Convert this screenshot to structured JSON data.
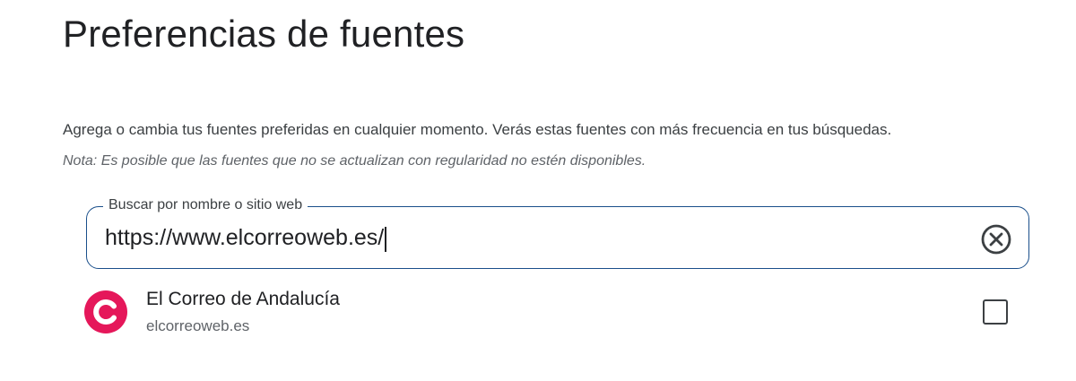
{
  "header": {
    "title": "Preferencias de fuentes"
  },
  "intro": {
    "description": "Agrega o cambia tus fuentes preferidas en cualquier momento. Verás estas fuentes con más frecuencia en tus búsquedas.",
    "note": "Nota: Es posible que las fuentes que no se actualizan con regularidad no estén disponibles."
  },
  "search": {
    "label": "Buscar por nombre o sitio web",
    "value": "https://www.elcorreoweb.es/",
    "clear_icon": "close-circle-icon"
  },
  "results": [
    {
      "name": "El Correo de Andalucía",
      "domain": "elcorreoweb.es",
      "logo_icon": "el-correo-logo-icon",
      "logo_color": "#e5175a",
      "checked": false
    }
  ],
  "colors": {
    "accent_border": "#1a4f8b",
    "text_primary": "#202124",
    "text_secondary": "#5f6368"
  }
}
